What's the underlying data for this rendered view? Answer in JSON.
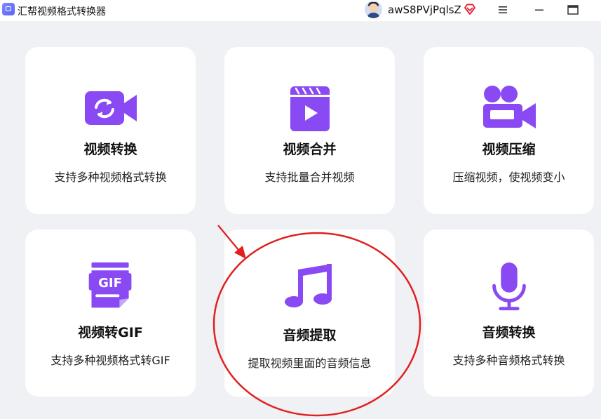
{
  "app": {
    "title": "汇帮视频格式转换器"
  },
  "user": {
    "name": "awS8PVjPqlsZ"
  },
  "window_controls": {
    "menu": "menu-icon",
    "minimize": "minimize-icon",
    "maximize": "maximize-icon"
  },
  "features": [
    {
      "title": "视频转换",
      "desc": "支持多种视频格式转换",
      "icon": "video-convert-icon"
    },
    {
      "title": "视频合并",
      "desc": "支持批量合并视频",
      "icon": "video-merge-icon"
    },
    {
      "title": "视频压缩",
      "desc": "压缩视频，使视频变小",
      "icon": "video-compress-icon"
    },
    {
      "title": "视频转GIF",
      "desc": "支持多种视频格式转GIF",
      "icon": "gif-icon"
    },
    {
      "title": "音频提取",
      "desc": "提取视频里面的音频信息",
      "icon": "music-note-icon"
    },
    {
      "title": "音频转换",
      "desc": "支持多种音频格式转换",
      "icon": "microphone-icon"
    }
  ],
  "colors": {
    "accent": "#8a4af3",
    "annotation": "#e02020",
    "background": "#f0f1f4"
  }
}
